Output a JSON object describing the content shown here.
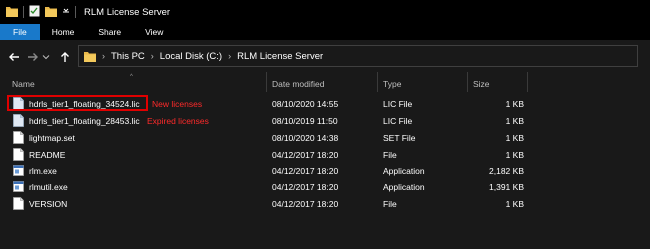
{
  "window": {
    "title": "RLM License Server"
  },
  "ribbon": {
    "tabs": [
      "File",
      "Home",
      "Share",
      "View"
    ]
  },
  "address": {
    "crumbs": [
      "This PC",
      "Local Disk (C:)",
      "RLM License Server"
    ]
  },
  "columns": {
    "name": "Name",
    "date": "Date modified",
    "type": "Type",
    "size": "Size"
  },
  "files": [
    {
      "name": "hdrls_tier1_floating_34524.lic",
      "date": "08/10/2020 14:55",
      "type": "LIC File",
      "size": "1 KB",
      "icon": "license-file-icon"
    },
    {
      "name": "hdrls_tier1_floating_28453.lic",
      "date": "08/10/2019 11:50",
      "type": "LIC File",
      "size": "1 KB",
      "icon": "license-file-icon"
    },
    {
      "name": "lightmap.set",
      "date": "08/10/2020 14:38",
      "type": "SET File",
      "size": "1 KB",
      "icon": "document-icon"
    },
    {
      "name": "README",
      "date": "04/12/2017 18:20",
      "type": "File",
      "size": "1 KB",
      "icon": "document-icon"
    },
    {
      "name": "rlm.exe",
      "date": "04/12/2017 18:20",
      "type": "Application",
      "size": "2,182 KB",
      "icon": "application-icon"
    },
    {
      "name": "rlmutil.exe",
      "date": "04/12/2017 18:20",
      "type": "Application",
      "size": "1,391 KB",
      "icon": "application-icon"
    },
    {
      "name": "VERSION",
      "date": "04/12/2017 18:20",
      "type": "File",
      "size": "1 KB",
      "icon": "document-icon"
    }
  ],
  "annotations": {
    "new": "New licenses",
    "expired": "Expired licenses"
  },
  "colors": {
    "file_tab": "#1979ca",
    "annotation": "#ff2a2a",
    "folder": "#e8b84a"
  }
}
